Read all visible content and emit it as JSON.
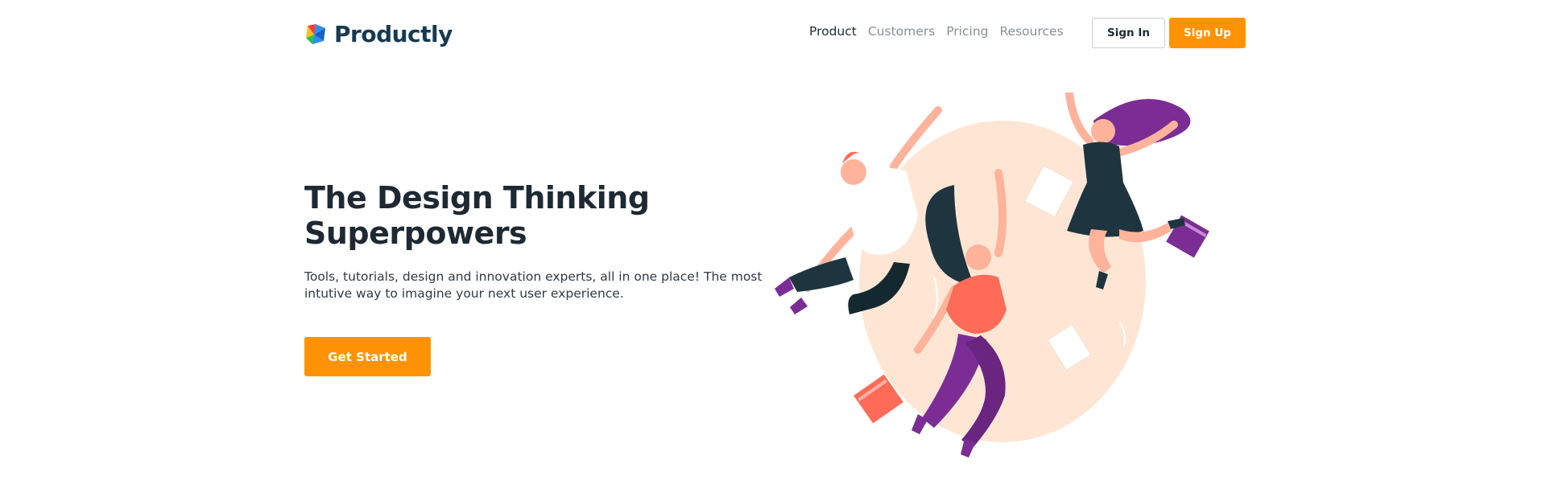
{
  "brand": {
    "name": "Productly",
    "icon": "productly-logo-icon"
  },
  "nav": {
    "items": [
      {
        "label": "Product",
        "active": true
      },
      {
        "label": "Customers",
        "active": false
      },
      {
        "label": "Pricing",
        "active": false
      },
      {
        "label": "Resources",
        "active": false
      }
    ]
  },
  "auth": {
    "sign_in": "Sign In",
    "sign_up": "Sign Up"
  },
  "hero": {
    "title": "The Design Thinking Superpowers",
    "subtitle": "Tools, tutorials, design and innovation experts, all in one place! The most intutive way to imagine your next user experience.",
    "cta": "Get Started",
    "illustration": "three-people-jumping-illustration"
  },
  "colors": {
    "accent": "#ff9305",
    "brand_text": "#173a52",
    "illustration_circle": "#ffe6d4",
    "purple": "#7b2d95",
    "coral": "#ff6b57",
    "dark": "#1e3540"
  }
}
